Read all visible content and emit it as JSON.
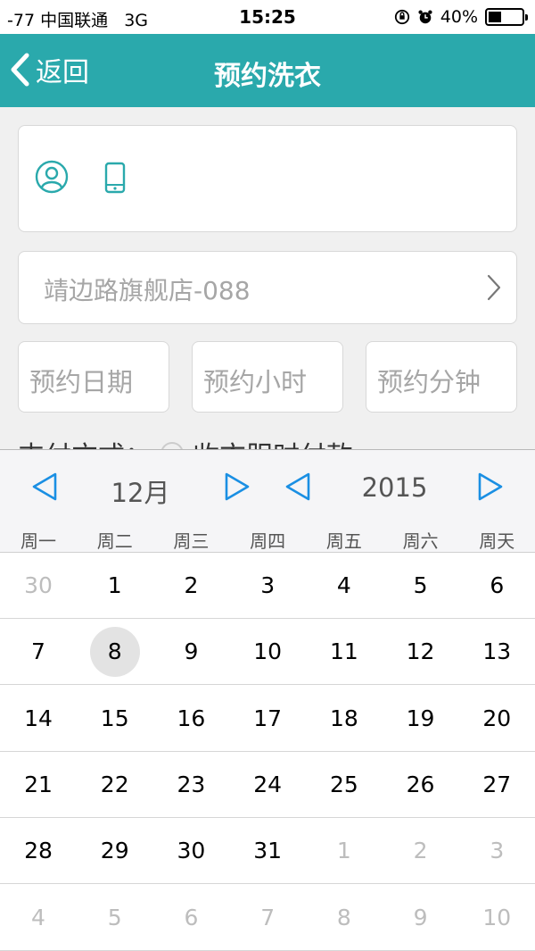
{
  "status_bar": {
    "carrier": "-77 中国联通",
    "network": "3G",
    "time": "15:25",
    "battery": "40%",
    "battery_level": 0.4,
    "icons": [
      "rotation-lock-icon",
      "alarm-icon"
    ]
  },
  "nav": {
    "back_label": "返回",
    "title": "预约洗衣",
    "background": "#2aa9ac"
  },
  "contact": {
    "icons": [
      "user-icon",
      "phone-icon"
    ]
  },
  "store": {
    "value": "靖边路旗舰店-088"
  },
  "time_fields": [
    {
      "placeholder": "预约日期"
    },
    {
      "placeholder": "预约小时"
    },
    {
      "placeholder": "预约分钟"
    }
  ],
  "payment": {
    "label": "支付方式：",
    "option": "收衣服时付款"
  },
  "calendar": {
    "month": "12月",
    "year": "2015",
    "weekdays": [
      "周一",
      "周二",
      "周三",
      "周四",
      "周五",
      "周六",
      "周天"
    ],
    "selected_day": "8",
    "accent": "#1a8fe3",
    "weeks": [
      [
        {
          "d": "30",
          "m": true
        },
        {
          "d": "1"
        },
        {
          "d": "2"
        },
        {
          "d": "3"
        },
        {
          "d": "4"
        },
        {
          "d": "5"
        },
        {
          "d": "6"
        }
      ],
      [
        {
          "d": "7"
        },
        {
          "d": "8",
          "sel": true
        },
        {
          "d": "9"
        },
        {
          "d": "10"
        },
        {
          "d": "11"
        },
        {
          "d": "12"
        },
        {
          "d": "13"
        }
      ],
      [
        {
          "d": "14"
        },
        {
          "d": "15"
        },
        {
          "d": "16"
        },
        {
          "d": "17"
        },
        {
          "d": "18"
        },
        {
          "d": "19"
        },
        {
          "d": "20"
        }
      ],
      [
        {
          "d": "21"
        },
        {
          "d": "22"
        },
        {
          "d": "23"
        },
        {
          "d": "24"
        },
        {
          "d": "25"
        },
        {
          "d": "26"
        },
        {
          "d": "27"
        }
      ],
      [
        {
          "d": "28"
        },
        {
          "d": "29"
        },
        {
          "d": "30"
        },
        {
          "d": "31"
        },
        {
          "d": "1",
          "m": true
        },
        {
          "d": "2",
          "m": true
        },
        {
          "d": "3",
          "m": true
        }
      ],
      [
        {
          "d": "4",
          "m": true
        },
        {
          "d": "5",
          "m": true
        },
        {
          "d": "6",
          "m": true
        },
        {
          "d": "7",
          "m": true
        },
        {
          "d": "8",
          "m": true
        },
        {
          "d": "9",
          "m": true
        },
        {
          "d": "10",
          "m": true
        }
      ]
    ]
  }
}
